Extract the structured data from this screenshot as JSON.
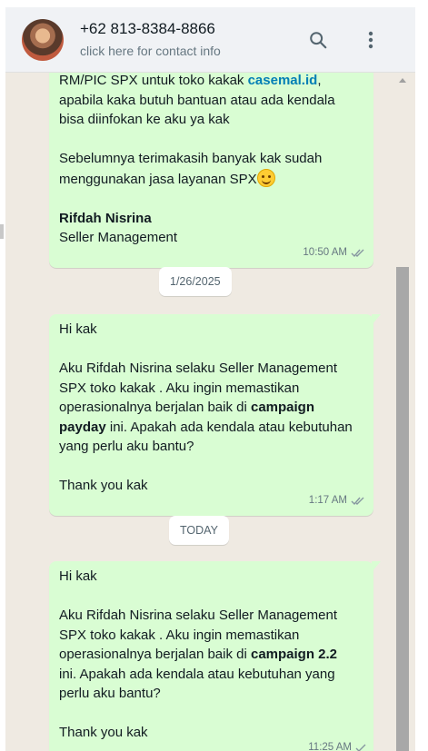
{
  "header": {
    "contact_name": "+62 813-8384-8866",
    "contact_subtitle": "click here for contact info",
    "search_icon": "search-icon",
    "menu_icon": "kebab-menu-icon"
  },
  "colors": {
    "outgoing_bubble": "#d9fdd3",
    "chat_background": "#efeae2",
    "header_background": "#f0f2f5",
    "link": "#027eb5",
    "read_tick": "#8696a0"
  },
  "messages": [
    {
      "lines": [
        "RM/PIC SPX untuk toko kakak ",
        "apabila kaka butuh bantuan atau ada kendala",
        "bisa diinfokan ke aku ya kak",
        "",
        "Sebelumnya terimakasih banyak kak sudah",
        "menggunakan jasa layanan SPX",
        "",
        "Rifdah Nisrina",
        "Seller Management"
      ],
      "link_text": "casemal.id",
      "after_link": ",",
      "emoji": "smiling-face-icon",
      "time": "10:50 AM",
      "status": "read"
    },
    {
      "lines": [
        "Hi kak",
        "",
        "Aku Rifdah Nisrina selaku Seller Management",
        "SPX toko kakak . Aku ingin memastikan",
        "operasionalnya berjalan baik di ",
        "payday",
        " ini. Apakah ada kendala atau kebutuhan",
        "yang perlu aku bantu?",
        "",
        "Thank you kak"
      ],
      "bold_1": "campaign",
      "time": "1:17 AM",
      "status": "read"
    },
    {
      "lines": [
        "Hi kak",
        "",
        "Aku Rifdah Nisrina selaku Seller Management",
        "SPX toko kakak . Aku ingin memastikan",
        "operasionalnya berjalan baik di ",
        "ini. Apakah ada kendala atau kebutuhan yang",
        "perlu aku bantu?",
        "",
        "Thank you kak"
      ],
      "bold_1": "campaign 2.2",
      "time": "11:25 AM",
      "status": "sent"
    }
  ],
  "date_separators": [
    "1/26/2025",
    "TODAY"
  ]
}
